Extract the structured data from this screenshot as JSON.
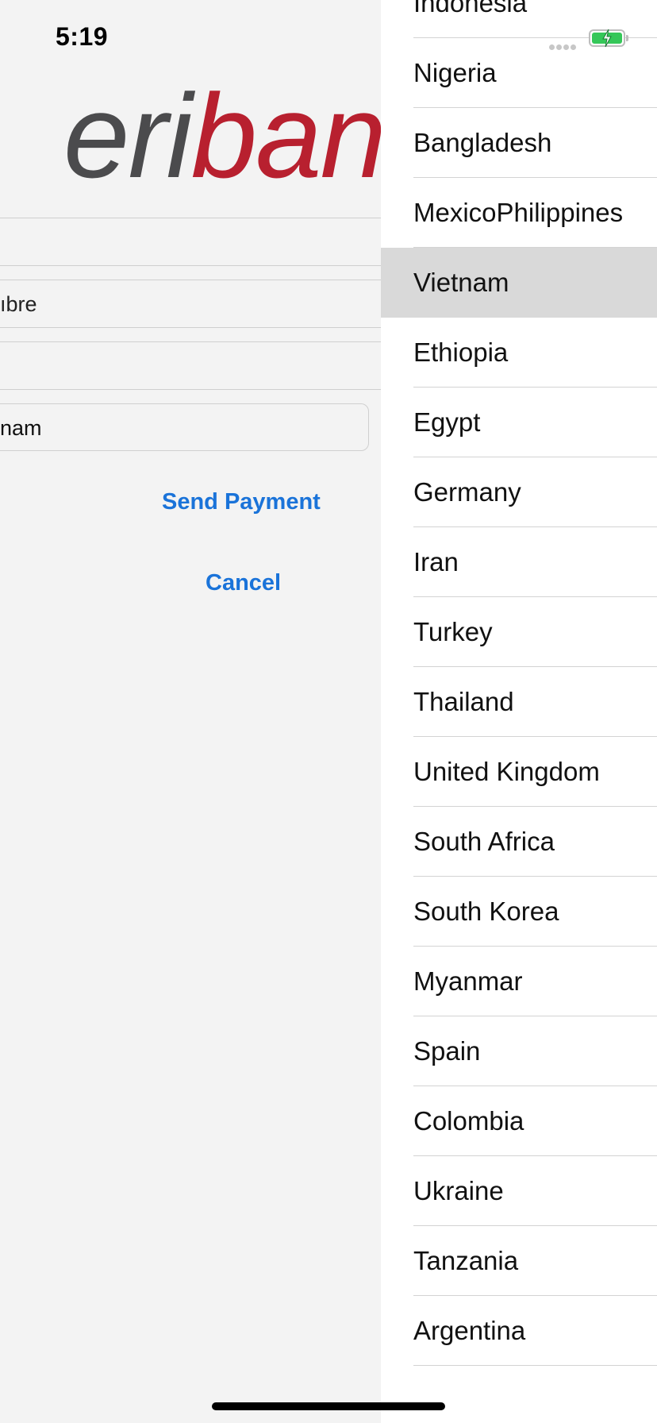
{
  "status": {
    "time": "5:19"
  },
  "logo": {
    "part1": "eri",
    "part2": "banl"
  },
  "form": {
    "partial_name": "ıbre",
    "country_value": "nam"
  },
  "actions": {
    "send_payment": "Send Payment",
    "cancel": "Cancel"
  },
  "picker": {
    "selected": "Vietnam",
    "countries": [
      "Indonesia",
      "Nigeria",
      "Bangladesh",
      "MexicoPhilippines",
      "Vietnam",
      "Ethiopia",
      "Egypt",
      "Germany",
      "Iran",
      "Turkey",
      "Thailand",
      "United Kingdom",
      "South Africa",
      "South Korea",
      "Myanmar",
      "Spain",
      "Colombia",
      "Ukraine",
      "Tanzania",
      "Argentina"
    ]
  },
  "colors": {
    "link": "#1a73d9",
    "logo_gray": "#4b4b4d",
    "logo_red": "#b8202f",
    "selected_row": "#d9d9d9",
    "battery": "#35c759"
  },
  "icons": {
    "battery": "battery-charging-icon",
    "signal": "signal-dots-icon"
  }
}
